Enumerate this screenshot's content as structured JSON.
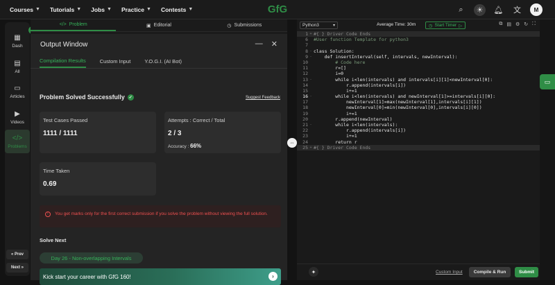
{
  "nav": {
    "items": [
      "Courses",
      "Tutorials",
      "Jobs",
      "Practice",
      "Contests"
    ],
    "logo": "GfG",
    "avatar": "M"
  },
  "sidebar": {
    "items": [
      {
        "label": "Dash",
        "icon": "dashboard-icon"
      },
      {
        "label": "All",
        "icon": "all-icon"
      },
      {
        "label": "Articles",
        "icon": "articles-icon"
      },
      {
        "label": "Videos",
        "icon": "videos-icon"
      },
      {
        "label": "Problems",
        "icon": "code-icon"
      }
    ],
    "prev": "« Prev",
    "next": "Next »"
  },
  "problem_tabs": [
    "Problem",
    "Editorial",
    "Submissions"
  ],
  "output": {
    "title": "Output Window",
    "tabs": [
      "Compilation Results",
      "Custom Input",
      "Y.O.G.I. (AI Bot)"
    ],
    "status": "Problem Solved Successfully",
    "suggest_feedback": "Suggest Feedback",
    "test_cases": {
      "label": "Test Cases Passed",
      "value": "1111 / 1111"
    },
    "attempts": {
      "label": "Attempts : Correct / Total",
      "value": "2 / 3",
      "accuracy_label": "Accuracy :",
      "accuracy_value": "66%"
    },
    "time": {
      "label": "Time Taken",
      "value": "0.69"
    },
    "warning": "You get marks only for the first correct submission if you solve the problem without viewing the full solution.",
    "solve_next_label": "Solve Next",
    "next_problem": "Day 26 - Non-overlapping Intervals",
    "banner": "Kick start your career with GfG 160!"
  },
  "editor": {
    "language": "Python3",
    "avg_time": "Average Time: 30m",
    "start_timer": "Start Timer",
    "lines": [
      {
        "n": "1",
        "text": "#{ } Driver Code Ends",
        "fold": "+"
      },
      {
        "n": "6",
        "text": "#User function Template for python3",
        "fold": ""
      },
      {
        "n": "7",
        "text": "",
        "fold": ""
      },
      {
        "n": "8",
        "text": "class Solution:",
        "fold": "-"
      },
      {
        "n": "9",
        "text": "    def insertInterval(self, intervals, newInterval):",
        "fold": "-"
      },
      {
        "n": "10",
        "text": "        # Code here",
        "fold": ""
      },
      {
        "n": "11",
        "text": "        r=[]",
        "fold": ""
      },
      {
        "n": "12",
        "text": "        i=0",
        "fold": ""
      },
      {
        "n": "13",
        "text": "        while i<len(intervals) and intervals[i][1]<newInterval[0]:",
        "fold": "-"
      },
      {
        "n": "14",
        "text": "            r.append(intervals[i])",
        "fold": ""
      },
      {
        "n": "15",
        "text": "            i+=1",
        "fold": ""
      },
      {
        "n": "16",
        "text": "        while i<len(intervals) and newInterval[1]>=intervals[i][0]:",
        "fold": "-"
      },
      {
        "n": "17",
        "text": "            newInterval[1]=max(newInterval[1],intervals[i][1])",
        "fold": ""
      },
      {
        "n": "18",
        "text": "            newInterval[0]=min(newInterval[0],intervals[i][0])",
        "fold": ""
      },
      {
        "n": "19",
        "text": "            i+=1",
        "fold": ""
      },
      {
        "n": "20",
        "text": "        r.append(newInterval)",
        "fold": ""
      },
      {
        "n": "21",
        "text": "        while i<len(intervals):",
        "fold": "-"
      },
      {
        "n": "22",
        "text": "            r.append(intervals[i])",
        "fold": ""
      },
      {
        "n": "23",
        "text": "            i+=1",
        "fold": ""
      },
      {
        "n": "24",
        "text": "        return r",
        "fold": ""
      },
      {
        "n": "25",
        "text": "#{ } Driver Code Ends",
        "fold": "+"
      }
    ],
    "custom_input": "Custom Input",
    "compile_run": "Compile & Run",
    "submit": "Submit"
  },
  "colors": {
    "accent": "#2f8d46",
    "error": "#f05050",
    "background": "#131313"
  }
}
